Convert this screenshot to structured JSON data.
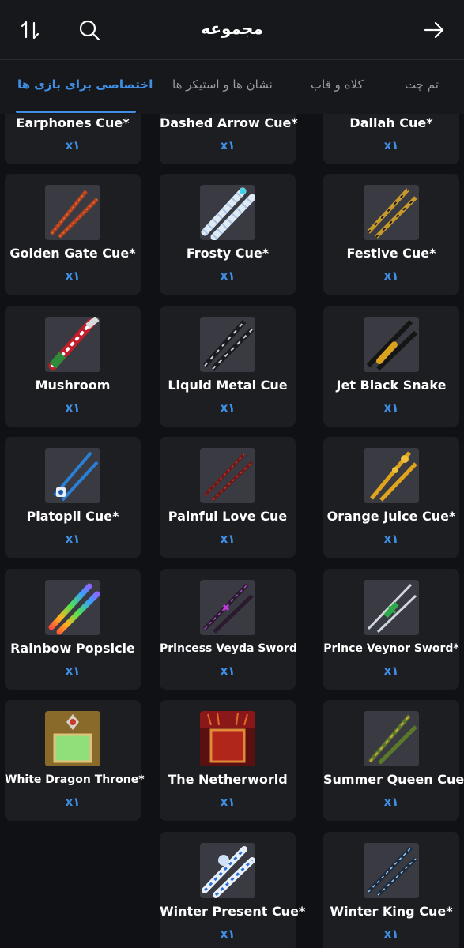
{
  "header": {
    "title": "مجموعه",
    "sort_icon": "sort-arrows-icon",
    "search_icon": "search-icon",
    "back_icon": "arrow-right-icon"
  },
  "tabs": [
    {
      "label": "اختصاصی برای بازی ها",
      "active": true
    },
    {
      "label": "نشان ها و استیکر ها",
      "active": false
    },
    {
      "label": "کلاه و قاب",
      "active": false
    },
    {
      "label": "تم چت",
      "active": false
    }
  ],
  "colors": {
    "accent": "#3f8fe6",
    "card": "#1d1e22",
    "background": "#101114"
  },
  "items": [
    {
      "label": "Earphones Cue*",
      "qty": "x۱"
    },
    {
      "label": "Dashed Arrow Cue*",
      "qty": "x۱"
    },
    {
      "label": "Dallah Cue*",
      "qty": "x۱"
    },
    {
      "label": "Golden Gate Cue*",
      "qty": "x۱"
    },
    {
      "label": "Frosty Cue*",
      "qty": "x۱"
    },
    {
      "label": "Festive Cue*",
      "qty": "x۱"
    },
    {
      "label": "Mushroom",
      "qty": "x۱"
    },
    {
      "label": "Liquid Metal Cue",
      "qty": "x۱"
    },
    {
      "label": "Jet Black Snake",
      "qty": "x۱"
    },
    {
      "label": "Platopii Cue*",
      "qty": "x۱"
    },
    {
      "label": "Painful Love Cue",
      "qty": "x۱"
    },
    {
      "label": "Orange Juice Cue*",
      "qty": "x۱"
    },
    {
      "label": "Rainbow Popsicle",
      "qty": "x۱"
    },
    {
      "label": "Princess Veyda Sword",
      "qty": "x۱"
    },
    {
      "label": "Prince Veynor Sword*",
      "qty": "x۱"
    },
    {
      "label": "White Dragon Throne*",
      "qty": "x۱"
    },
    {
      "label": "The Netherworld",
      "qty": "x۱"
    },
    {
      "label": "Summer Queen Cue*",
      "qty": "x۱"
    },
    {
      "label": "Winter Present Cue*",
      "qty": "x۱"
    },
    {
      "label": "Winter King Cue*",
      "qty": "x۱"
    }
  ]
}
